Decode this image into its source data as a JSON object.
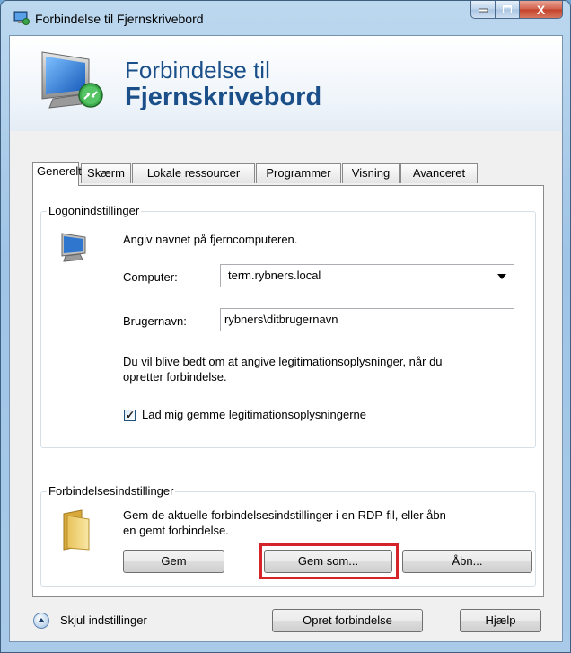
{
  "window": {
    "title": "Forbindelse til Fjernskrivebord",
    "close_glyph": "X"
  },
  "banner": {
    "line1": "Forbindelse til",
    "line2": "Fjernskrivebord"
  },
  "tabs": [
    "Generelt",
    "Skærm",
    "Lokale ressourcer",
    "Programmer",
    "Visning",
    "Avanceret"
  ],
  "logon": {
    "group_label": "Logonindstillinger",
    "instruction": "Angiv navnet på fjerncomputeren.",
    "computer_label": "Computer:",
    "computer_value": "term.rybners.local",
    "username_label": "Brugernavn:",
    "username_value": "rybners\\ditbrugernavn",
    "info_line1": "Du vil blive bedt om at angive legitimationsoplysninger, når du",
    "info_line2": "opretter forbindelse.",
    "save_credentials_label": "Lad mig gemme legitimationsoplysningerne",
    "save_credentials_checked": true
  },
  "connection": {
    "group_label": "Forbindelsesindstillinger",
    "desc_line1": "Gem de aktuelle forbindelsesindstillinger i en RDP-fil, eller åbn",
    "desc_line2": "en gemt forbindelse.",
    "save_label": "Gem",
    "save_as_label": "Gem som...",
    "open_label": "Åbn..."
  },
  "footer": {
    "hide_options_label": "Skjul indstillinger",
    "connect_label": "Opret forbindelse",
    "help_label": "Hjælp"
  },
  "colors": {
    "highlight": "#d5232a",
    "banner_text": "#1b4f8a"
  },
  "icons": {
    "title": "remote-desktop-icon",
    "banner": "remote-desktop-large-icon",
    "computer": "computer-icon",
    "folder": "folder-icon",
    "collapse": "chevron-up-circle-icon"
  }
}
